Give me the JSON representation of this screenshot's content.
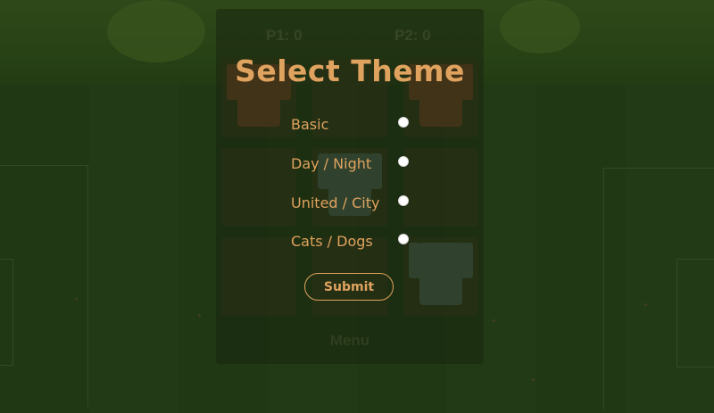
{
  "scoreboard": {
    "p1": "P1: 0",
    "p2": "P2: 0"
  },
  "board": {
    "menu_label": "Menu"
  },
  "theme_modal": {
    "title": "Select Theme",
    "options": [
      {
        "label": "Basic"
      },
      {
        "label": "Day / Night"
      },
      {
        "label": "United / City"
      },
      {
        "label": "Cats / Dogs"
      }
    ],
    "submit_label": "Submit"
  },
  "colors": {
    "accent": "#e0a35f",
    "pitch": "#26401a",
    "radio": "#ffffff"
  }
}
